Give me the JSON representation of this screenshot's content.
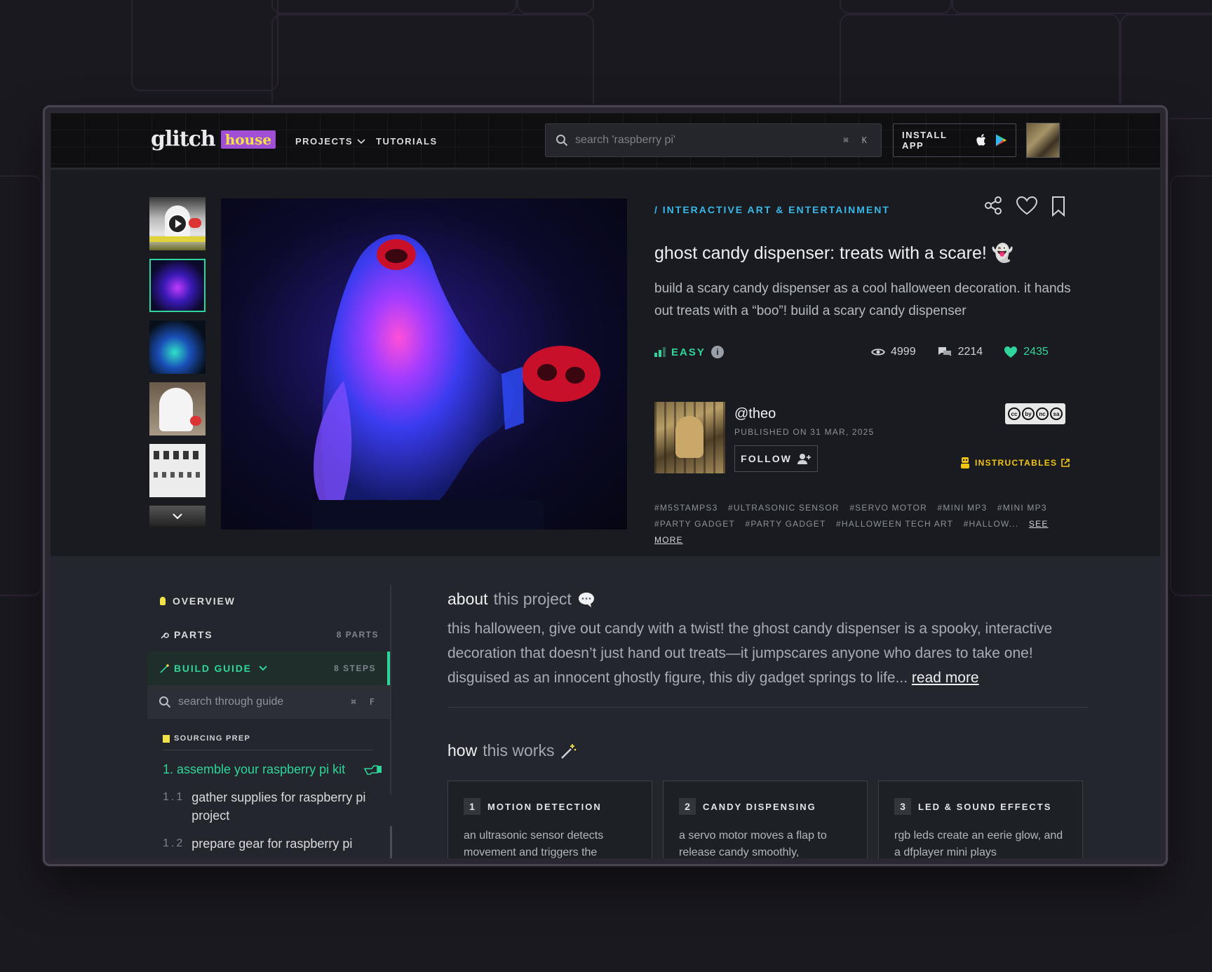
{
  "nav": {
    "logo_main": "glitch",
    "logo_badge": "house",
    "projects_label": "PROJECTS",
    "tutorials_label": "TUTORIALS",
    "search_placeholder": "search 'raspberry pi'",
    "search_shortcut": "⌘ K",
    "install_label": "INSTALL APP"
  },
  "project": {
    "category": "/ INTERACTIVE ART & ENTERTAINMENT",
    "title": "ghost candy dispenser: treats with a scare! 👻",
    "description": "build a scary candy dispenser as a cool halloween decoration. it hands out treats with a “boo”! build a scary candy dispenser",
    "difficulty": "EASY",
    "views": "4999",
    "comments": "2214",
    "likes": "2435",
    "author": "@theo",
    "published": "PUBLISHED ON 31 MAR, 2025",
    "follow_label": "FOLLOW",
    "license": [
      "cc",
      "by",
      "nc",
      "sa"
    ],
    "source_label": "INSTRUCTABLES",
    "tags_row1": [
      "#M5STAMPS3",
      "#ULTRASONIC SENSOR",
      "#SERVO MOTOR",
      "#MINI MP3",
      "#MINI MP3"
    ],
    "tags_row2": [
      "#PARTY GADGET",
      "#PARTY GADGET",
      "#HALLOWEEN TECH ART",
      "#HALLOW..."
    ],
    "see_more_label": "SEE MORE"
  },
  "sidebar": {
    "overview_label": "OVERVIEW",
    "parts_label": "PARTS",
    "parts_count": "8 PARTS",
    "guide_label": "BUILD GUIDE",
    "guide_count": "8 STEPS",
    "search_placeholder": "search through guide",
    "search_shortcut": "⌘ F",
    "section_label": "SOURCING PREP",
    "steps": [
      {
        "num": "",
        "label": "1. assemble your raspberry pi kit"
      },
      {
        "num": "1.1",
        "label": "gather supplies for raspberry pi project"
      },
      {
        "num": "1.2",
        "label": "prepare gear for raspberry pi"
      }
    ]
  },
  "about": {
    "heading_strong": "about",
    "heading_dim": "this project",
    "body": "this halloween, give out candy with a twist! the ghost candy dispenser is a spooky, interactive decoration that doesn’t just hand out treats—it jumpscares anyone who dares to take one! disguised as an innocent ghostly figure, this diy gadget springs to life...",
    "read_more_label": "read more"
  },
  "how": {
    "heading_strong": "how",
    "heading_dim": "this works",
    "cards": [
      {
        "num": "1",
        "title": "MOTION DETECTION",
        "body": "an ultrasonic sensor detects movement and triggers the"
      },
      {
        "num": "2",
        "title": "CANDY DISPENSING",
        "body": "a servo motor moves a flap to release candy smoothly,"
      },
      {
        "num": "3",
        "title": "LED & SOUND EFFECTS",
        "body": "rgb leds create an eerie glow, and a dfplayer mini plays"
      }
    ]
  },
  "colors": {
    "accent_green": "#2fd59a",
    "accent_blue": "#39b8e8",
    "brand_purple": "#a24fd8",
    "brand_yellow": "#f2e24a",
    "instructables_yellow": "#f1c515"
  }
}
